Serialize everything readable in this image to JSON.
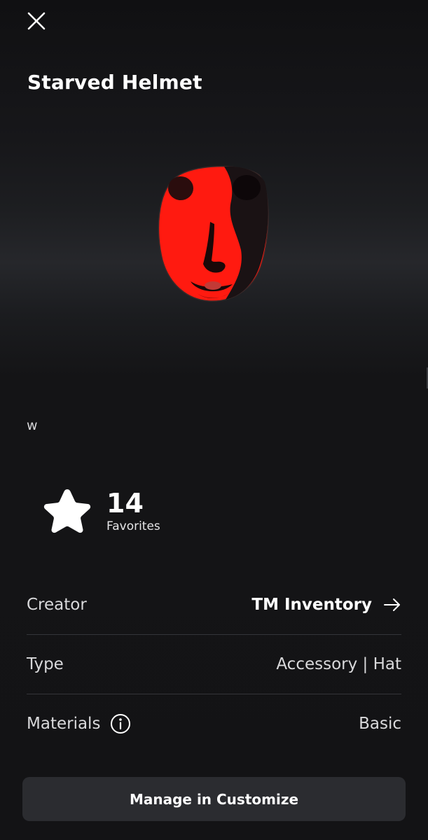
{
  "item": {
    "title": "Starved Helmet",
    "description": "w",
    "preview_icon": "red-face-helmet"
  },
  "favorites": {
    "count": "14",
    "label": "Favorites",
    "icon": "star-icon"
  },
  "details": {
    "creator_label": "Creator",
    "creator_value": "TM Inventory",
    "type_label": "Type",
    "type_value": "Accessory | Hat",
    "materials_label": "Materials",
    "materials_value": "Basic"
  },
  "actions": {
    "manage_label": "Manage in Customize",
    "close_icon": "close-icon"
  },
  "colors": {
    "background": "#141416",
    "helmet_red": "#ff1a10",
    "button_bg": "#2b2c30"
  }
}
